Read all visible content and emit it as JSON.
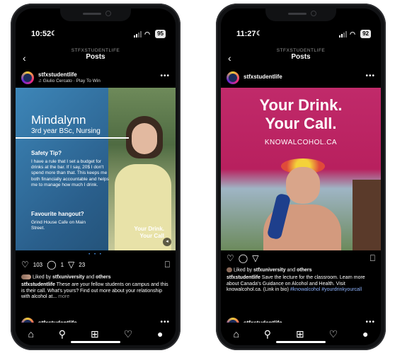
{
  "left_phone": {
    "status": {
      "time": "10:52",
      "battery": "95"
    },
    "header": {
      "account": "STFXSTUDENTLIFE",
      "title": "Posts",
      "back_icon": "chevron-left-icon"
    },
    "post": {
      "username": "stfxstudentlife",
      "music": "♫ Giulio Cercato · Play To Win",
      "image": {
        "name": "Mindalynn",
        "program": "3rd year BSc, Nursing",
        "tip_heading": "Safety Tip?",
        "tip_body": "I have a rule that I set a budget for drinks at the bar. If I say, 20$ I don't spend more than that. This keeps me both financially accountable and helps me to manage how much I drink.",
        "hangout_heading": "Favourite hangout?",
        "hangout_body": "Grind House Cafe on Main Street.",
        "overlay_tag": "Your Drink. Your Call"
      },
      "likes_count": "103",
      "comments_count": "1",
      "shares_count": "23",
      "liked_by_prefix": "Liked by",
      "liked_by_user": "stfxuniversity",
      "liked_by_and": "and",
      "liked_by_others": "others",
      "caption_user": "stfxstudentlife",
      "caption_text": "These are your fellow students on campus and this is their call. What's yours? Find out more about your relationship with alcohol at...",
      "more_label": "more"
    },
    "next_post_username": "stfxstudentlife"
  },
  "right_phone": {
    "status": {
      "time": "11:27",
      "battery": "92"
    },
    "header": {
      "account": "STFXSTUDENTLIFE",
      "title": "Posts",
      "back_icon": "chevron-left-icon"
    },
    "post": {
      "username": "stfxstudentlife",
      "image": {
        "headline_1": "Your Drink.",
        "headline_2": "Your Call.",
        "brand": "KNOWALCOHOL.CA"
      },
      "liked_by_prefix": "Liked by",
      "liked_by_user": "stfxuniversity",
      "liked_by_and": "and",
      "liked_by_others": "others",
      "caption_user": "stfxstudentlife",
      "caption_text": "Save the lecture for the classroom. Learn more about Canada's Guidance on Alcohol and Health. Visit knowalcohol.ca. (Link in bio)",
      "hashtags": "#knowalcohol #yourdrinkyourcall"
    },
    "next_post_username": "stfxstudentlife"
  },
  "colors": {
    "pink_bg": "#b8205e",
    "blue_bg": "#2f6f9e",
    "accent_yellow": "#f4d23a"
  }
}
